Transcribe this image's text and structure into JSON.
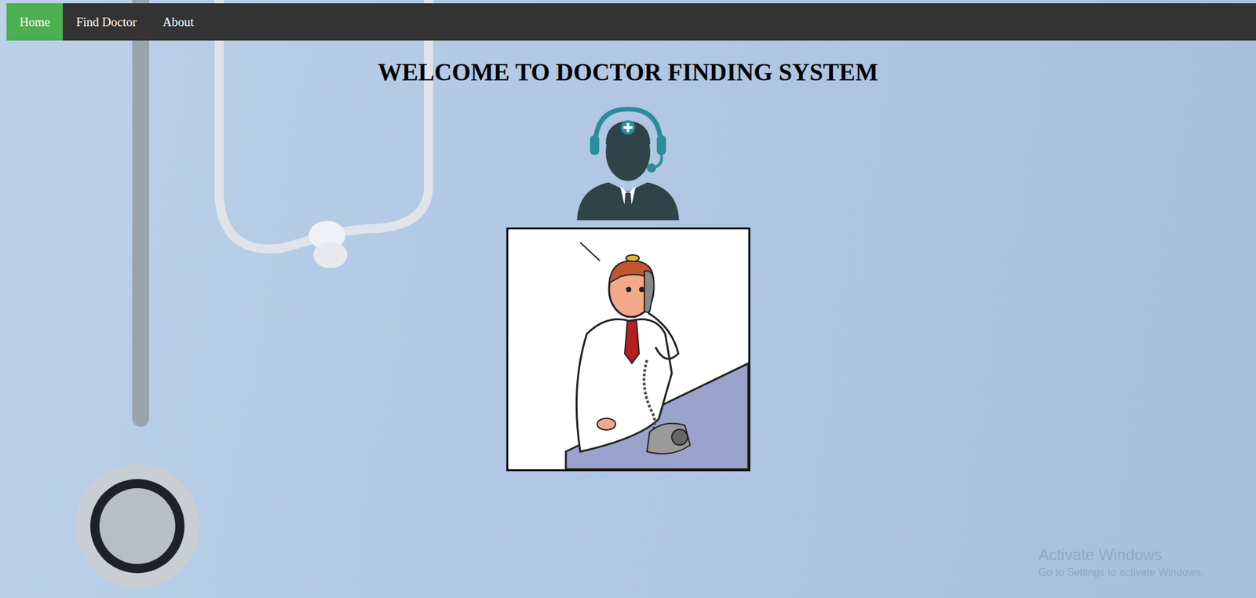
{
  "nav": {
    "items": [
      {
        "label": "Home",
        "selected": true
      },
      {
        "label": "Find Doctor",
        "selected": false
      },
      {
        "label": "About",
        "selected": false
      }
    ]
  },
  "title": "WELCOME TO DOCTOR FINDING SYSTEM",
  "watermark": {
    "title": "Activate Windows",
    "subtitle": "Go to Settings to activate Windows."
  }
}
